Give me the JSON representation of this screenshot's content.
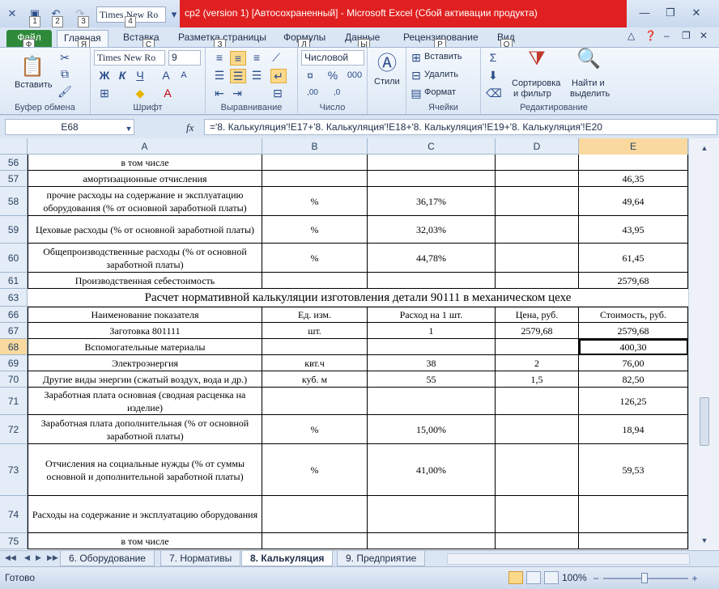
{
  "window": {
    "title": "cp2 (version 1) [Автосохраненный]  -  Microsoft Excel (Сбой активации продукта)",
    "controls": [
      "minimize",
      "restore",
      "close"
    ]
  },
  "qat": {
    "font_name": "Times New Ro",
    "keytips": [
      "1",
      "2",
      "3",
      "4"
    ]
  },
  "ribbon_tabs": [
    {
      "label": "Файл",
      "keytip": "Ф"
    },
    {
      "label": "Главная",
      "keytip": "Я"
    },
    {
      "label": "Вставка",
      "keytip": "С"
    },
    {
      "label": "Разметка страницы",
      "keytip": "З"
    },
    {
      "label": "Формулы",
      "keytip": "Л"
    },
    {
      "label": "Данные",
      "keytip": "Ы"
    },
    {
      "label": "Рецензирование",
      "keytip": "Р"
    },
    {
      "label": "Вид",
      "keytip": "О"
    }
  ],
  "ribbon": {
    "clipboard": {
      "label": "Буфер обмена",
      "paste": "Вставить"
    },
    "font": {
      "label": "Шрифт",
      "name": "Times New Ro",
      "size": "9"
    },
    "alignment": {
      "label": "Выравнивание"
    },
    "number": {
      "label": "Число",
      "format": "Числовой"
    },
    "styles": {
      "label": "Стили"
    },
    "cells": {
      "label": "Ячейки",
      "insert": "Вставить",
      "delete": "Удалить",
      "format": "Формат"
    },
    "editing": {
      "label": "Редактирование",
      "sort": "Сортировка",
      "sort2": "и фильтр",
      "find": "Найти и",
      "find2": "выделить"
    }
  },
  "formula_bar": {
    "name_box": "E68",
    "formula": "='8. Калькуляция'!E17+'8. Калькуляция'!E18+'8. Калькуляция'!E19+'8. Калькуляция'!E20"
  },
  "columns": [
    "A",
    "B",
    "C",
    "D",
    "E"
  ],
  "rows": [
    {
      "num": "56",
      "a": "в том числе",
      "b": "",
      "c": "",
      "d": "",
      "e": ""
    },
    {
      "num": "57",
      "a": "амортизационные отчисления",
      "b": "",
      "c": "",
      "d": "",
      "e": "46,35"
    },
    {
      "num": "58",
      "a": "прочие расходы на содержание и эксплуатацию оборудования (% от основной заработной платы)",
      "b": "%",
      "c": "36,17%",
      "d": "",
      "e": "49,64"
    },
    {
      "num": "59",
      "a": "Цеховые расходы (% от основной заработной платы)",
      "b": "%",
      "c": "32,03%",
      "d": "",
      "e": "43,95"
    },
    {
      "num": "60",
      "a": "Общепроизводственные расходы (% от основной заработной платы)",
      "b": "%",
      "c": "44,78%",
      "d": "",
      "e": "61,45"
    },
    {
      "num": "61",
      "a": "Производственная себестоимость",
      "b": "",
      "c": "",
      "d": "",
      "e": "2579,68"
    },
    {
      "num": "63",
      "title": "Расчет нормативной калькуляции изготовления детали 90111 в механическом цехе"
    },
    {
      "num": "66",
      "a": "Наименование показателя",
      "b": "Ед. изм.",
      "c": "Расход на 1 шт.",
      "d": "Цена, руб.",
      "e": "Стоимость, руб."
    },
    {
      "num": "67",
      "a": "Заготовка 801111",
      "b": "шт.",
      "c": "1",
      "d": "2579,68",
      "e": "2579,68"
    },
    {
      "num": "68",
      "a": "Вспомогательные материалы",
      "b": "",
      "c": "",
      "d": "",
      "e": "400,30"
    },
    {
      "num": "69",
      "a": "Электроэнергия",
      "b": "квт.ч",
      "c": "38",
      "d": "2",
      "e": "76,00"
    },
    {
      "num": "70",
      "a": "Другие виды энергии (сжатый воздух, вода и др.)",
      "b": "куб. м",
      "c": "55",
      "d": "1,5",
      "e": "82,50"
    },
    {
      "num": "71",
      "a": "Заработная плата основная (сводная расценка на изделие)",
      "b": "",
      "c": "",
      "d": "",
      "e": "126,25"
    },
    {
      "num": "72",
      "a": "Заработная плата дополнительная (% от основной заработной платы)",
      "b": "%",
      "c": "15,00%",
      "d": "",
      "e": "18,94"
    },
    {
      "num": "73",
      "a": "Отчисления на социальные нужды (% от суммы основной и дополнительной заработной платы)",
      "b": "%",
      "c": "41,00%",
      "d": "",
      "e": "59,53"
    },
    {
      "num": "74",
      "a": "Расходы на содержание и эксплуатацию оборудования",
      "b": "",
      "c": "",
      "d": "",
      "e": ""
    },
    {
      "num": "75",
      "a": "в том числе",
      "b": "",
      "c": "",
      "d": "",
      "e": ""
    }
  ],
  "sheet_tabs": [
    "6. Оборудование",
    "7. Нормативы",
    "8. Калькуляция",
    "9. Предприятие"
  ],
  "status": {
    "ready": "Готово",
    "zoom": "100%"
  }
}
